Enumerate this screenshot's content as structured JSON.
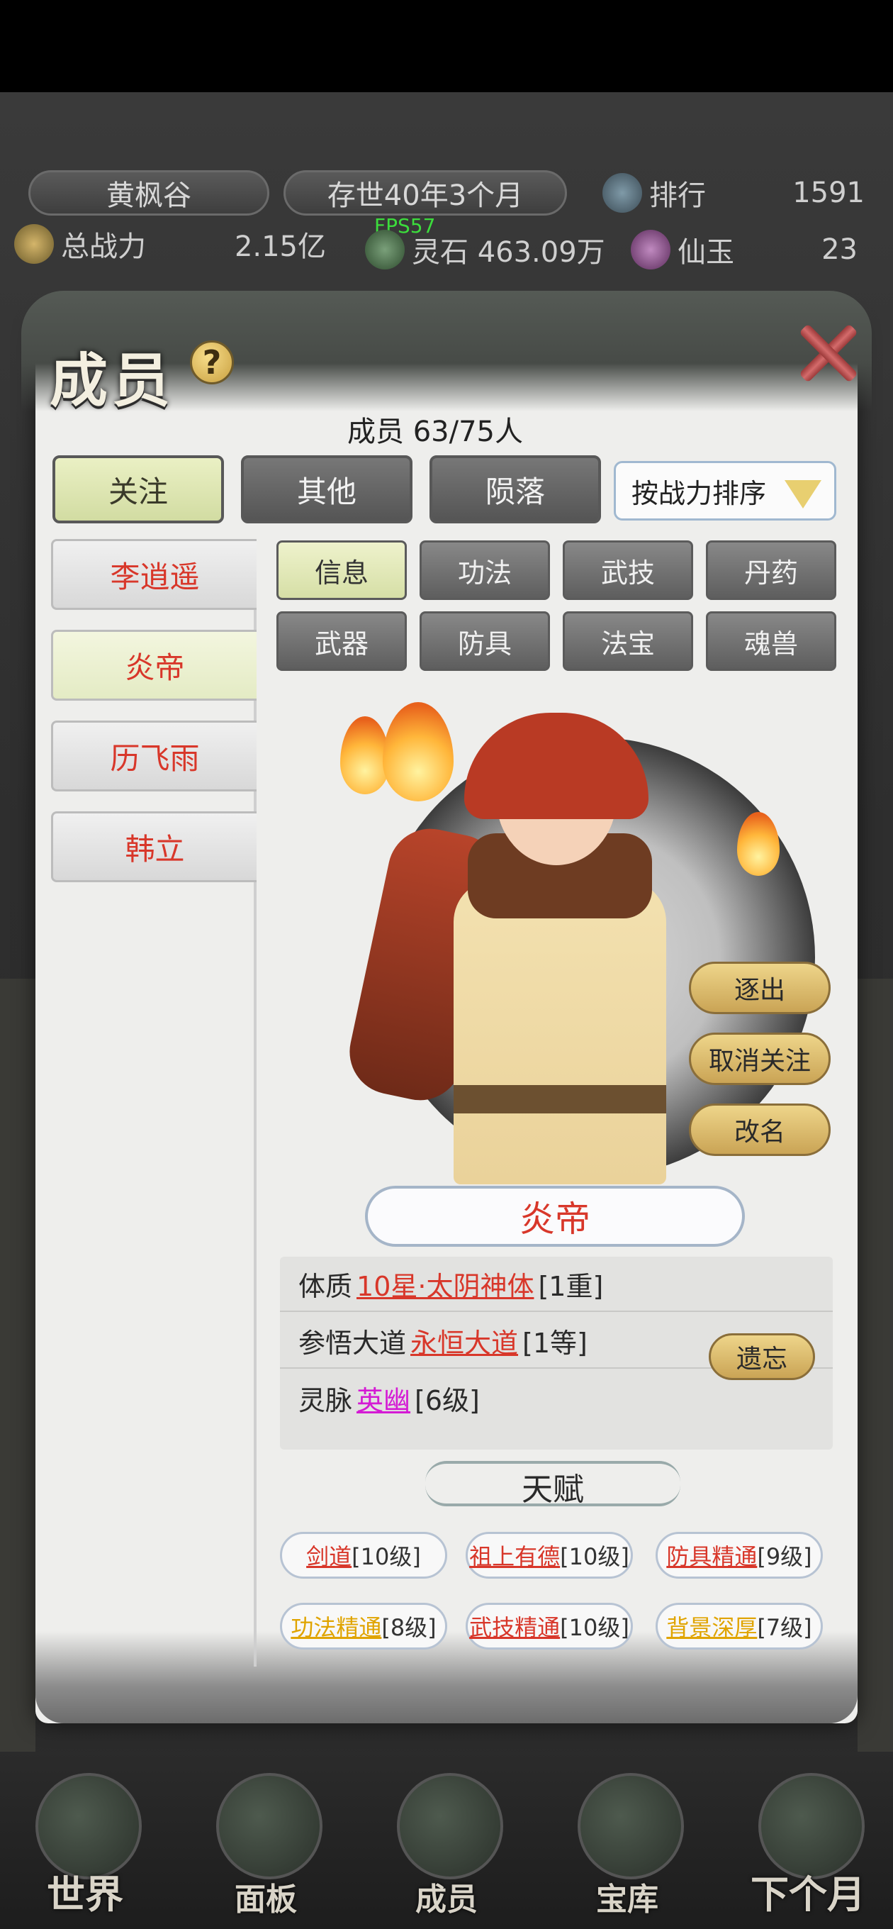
{
  "top_bar": {
    "sect_name": "黄枫谷",
    "age": "存世40年3个月",
    "rank_label": "排行",
    "rank_value": "1591",
    "power_label": "总战力",
    "power_value": "2.15亿",
    "fps": "FPS57",
    "spirit_stone": "灵石 463.09万",
    "jade_label": "仙玉",
    "jade_value": "23"
  },
  "dialog": {
    "title": "成员",
    "member_count": "成员  63/75人",
    "tabs": [
      {
        "label": "关注",
        "active": true
      },
      {
        "label": "其他",
        "active": false
      },
      {
        "label": "陨落",
        "active": false
      }
    ],
    "sort": "按战力排序",
    "members": [
      {
        "name": "李逍遥",
        "selected": false
      },
      {
        "name": "炎帝",
        "selected": true
      },
      {
        "name": "历飞雨",
        "selected": false
      },
      {
        "name": "韩立",
        "selected": false
      }
    ],
    "sub_tabs": [
      {
        "label": "信息",
        "active": true
      },
      {
        "label": "功法",
        "active": false
      },
      {
        "label": "武技",
        "active": false
      },
      {
        "label": "丹药",
        "active": false
      },
      {
        "label": "武器",
        "active": false
      },
      {
        "label": "防具",
        "active": false
      },
      {
        "label": "法宝",
        "active": false
      },
      {
        "label": "魂兽",
        "active": false
      }
    ],
    "actions": {
      "expel": "逐出",
      "unfollow": "取消关注",
      "rename": "改名"
    },
    "character_name": "炎帝",
    "info": {
      "constitution_label": "体质",
      "constitution_value": "10星·太阴神体",
      "constitution_level": "[1重]",
      "dao_label": "参悟大道",
      "dao_value": "永恒大道",
      "dao_level": "[1等]",
      "forget_button": "遗忘",
      "vein_label": "灵脉",
      "vein_value": "英幽",
      "vein_level": "[6级]"
    },
    "talent_title": "天赋",
    "talents": [
      {
        "name": "剑道",
        "level": "[10级]",
        "color": "#d8372a"
      },
      {
        "name": "祖上有德",
        "level": "[10级]",
        "color": "#d8372a"
      },
      {
        "name": "防具精通",
        "level": "[9级]",
        "color": "#d8372a"
      },
      {
        "name": "功法精通",
        "level": "[8级]",
        "color": "#e0a400"
      },
      {
        "name": "武技精通",
        "level": "[10级]",
        "color": "#d8372a"
      },
      {
        "name": "背景深厚",
        "level": "[7级]",
        "color": "#e0a400"
      }
    ]
  },
  "bottom_nav": [
    {
      "label": "世界"
    },
    {
      "label": "面板"
    },
    {
      "label": "成员"
    },
    {
      "label": "宝库"
    },
    {
      "label": "下个月"
    }
  ]
}
